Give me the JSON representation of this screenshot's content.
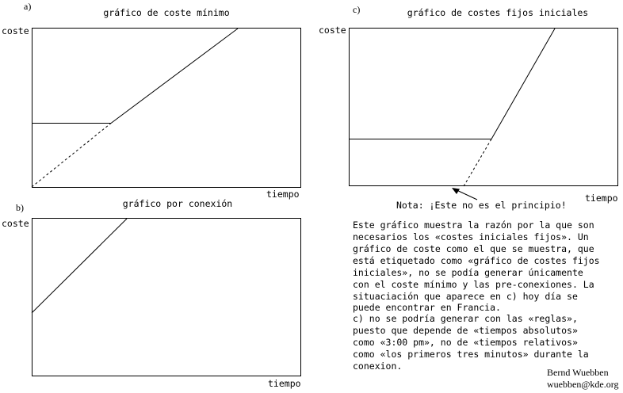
{
  "panel_a": {
    "letter": "a)",
    "title": "gráfico de coste mínimo",
    "ylabel": "coste",
    "xlabel": "tiempo"
  },
  "panel_b": {
    "letter": "b)",
    "title": "gráfico por conexión",
    "ylabel": "coste",
    "xlabel": "tiempo"
  },
  "panel_c": {
    "letter": "c)",
    "title": "gráfico de costes fijos iniciales",
    "ylabel": "coste",
    "xlabel": "tiempo",
    "note": "Nota: ¡Este no es el principio!"
  },
  "explanation": {
    "lines": [
      "Este gráfico muestra la razón por la que son",
      "necesarios los «costes iniciales fijos». Un",
      "gráfico de coste como el que se muestra, que",
      "está etiquetado como «gráfico de costes fijos",
      "iniciales», no se podía generar únicamente",
      "con el coste mínimo y las pre-conexiones. La",
      "situaciación que aparece en c) hoy día se",
      "puede encontrar en Francia.",
      "c) no se podría generar con las «reglas»,",
      "puesto que depende de «tiempos absolutos»",
      "como «3:00 pm», no de «tiempos relativos»",
      "como «los primeros tres minutos» durante la",
      "conexion."
    ]
  },
  "author": {
    "name": "Bernd Wuebben",
    "email": "wuebben@kde.org"
  }
}
